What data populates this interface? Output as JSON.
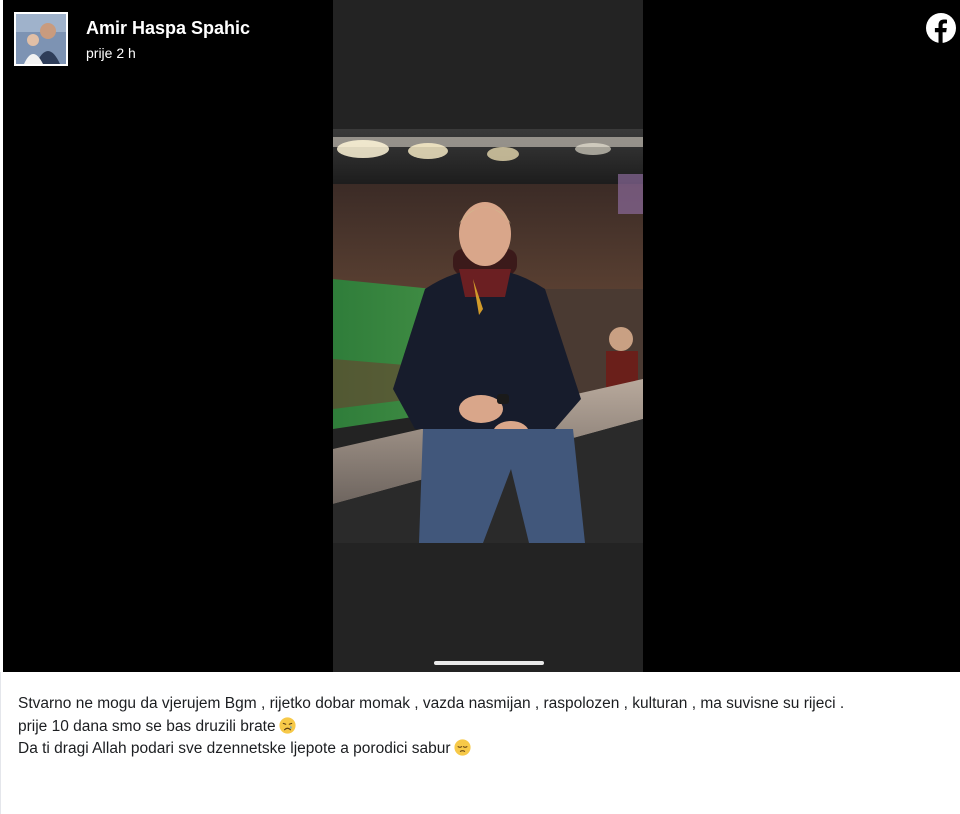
{
  "post": {
    "author": "Amir Haspa Spahic",
    "time": "prije 2 h",
    "icons": {
      "avatar": "profile-photo",
      "logo": "facebook-icon"
    },
    "media": {
      "description_icon": "stadium-photo"
    },
    "caption": {
      "line1": "Stvarno ne mogu da vjerujem Bgm , rijetko dobar momak , vazda nasmijan , raspolozen , kulturan , ma suvisne su rijeci .",
      "line2": "prije 10 dana smo se bas druzili brate",
      "line2_emoji": "crying-face-icon",
      "line3": "Da ti dragi Allah podari sve dzennetske ljepote a porodici sabur",
      "line3_emoji": "relieved-face-icon"
    },
    "colors": {
      "media_bg": "#000000",
      "phone_bg": "#232323",
      "text": "#1c1e21",
      "facebook_logo": "#ffffff"
    }
  }
}
